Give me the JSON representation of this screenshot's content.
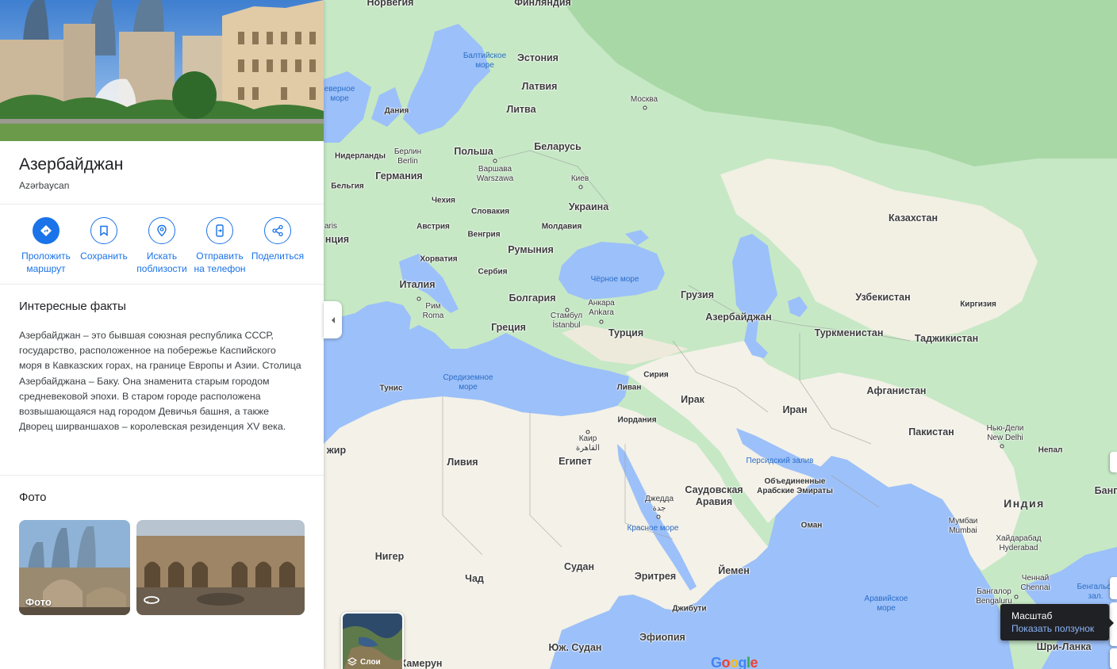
{
  "place": {
    "title": "Азербайджан",
    "subtitle": "Azərbaycan"
  },
  "actions": [
    {
      "label": "Проложить\nмаршрут",
      "icon": "directions-icon"
    },
    {
      "label": "Сохранить",
      "icon": "bookmark-icon"
    },
    {
      "label": "Искать\nпоблизости",
      "icon": "nearby-icon"
    },
    {
      "label": "Отправить\nна телефон",
      "icon": "send-to-phone-icon"
    },
    {
      "label": "Поделиться",
      "icon": "share-icon"
    }
  ],
  "facts": {
    "title": "Интересные факты",
    "text": "Азербайджан – это бывшая союзная республика СССР, государство, расположенное на побережье Каспийского моря в Кавказских горах, на границе Европы и Азии. Столица Азербайджана – Баку. Она знаменита старым городом средневековой эпохи. В старом городе расположена возвышающаяся над городом Девичья башня, а также Дворец ширваншахов – королевская резиденция XV века."
  },
  "photos": {
    "title": "Фото",
    "first_caption": "Фото",
    "second_icon": "360-view-icon"
  },
  "map": {
    "labels": {
      "norway": "Норвегия",
      "finland": "Финляндия",
      "estonia": "Эстония",
      "latvia": "Латвия",
      "lithuania": "Литва",
      "denmark": "Дания",
      "belarus": "Беларусь",
      "poland": "Польша",
      "germany": "Германия",
      "netherlands": "Нидерланды",
      "belgium": "Бельгия",
      "czechia": "Чехия",
      "slovakia": "Словакия",
      "austria": "Австрия",
      "hungary": "Венгрия",
      "moldova": "Молдавия",
      "ukraine": "Украина",
      "romania": "Румыния",
      "croatia": "Хорватия",
      "serbia": "Сербия",
      "italy": "Италия",
      "bulgaria": "Болгария",
      "greece": "Греция",
      "turkey": "Турция",
      "georgia": "Грузия",
      "azerbaijan": "Азербайджан",
      "kazakhstan": "Казахстан",
      "uzbekistan": "Узбекистан",
      "kyrgyzstan": "Киргизия",
      "turkmenistan": "Туркменистан",
      "tajikistan": "Таджикистан",
      "afghanistan": "Афганистан",
      "iran": "Иран",
      "iraq": "Ирак",
      "syria": "Сирия",
      "lebanon": "Ливан",
      "jordan": "Иордания",
      "pakistan": "Пакистан",
      "india": "Индия",
      "nepal": "Непал",
      "tunisia": "Тунис",
      "libya": "Ливия",
      "egypt": "Египет",
      "saudi": "Саудовская\nАравия",
      "uae": "Объединенные\nАрабские Эмираты",
      "oman": "Оман",
      "yemen": "Йемен",
      "sudan": "Судан",
      "eritrea": "Эритрея",
      "djibouti": "Джибути",
      "ethiopia": "Эфиопия",
      "south_sudan": "Юж. Судан",
      "chad": "Чад",
      "niger": "Нигер",
      "algeria_part": "жир",
      "cameroon": "Камерун",
      "france_part": "нция",
      "paris_part": "aris",
      "sri_lanka": "Шри-Ланка",
      "bangladesh_part": "Банг",
      "moscow": "Москва",
      "berlin": "Берлин\nBerlin",
      "warsaw": "Варшава\nWarszawa",
      "kyiv": "Киев",
      "rome": "Рим\nRoma",
      "istanbul": "Стамбул\nİstanbul",
      "ankara": "Анкара\nAnkara",
      "cairo": "Каир\nالقاهرة",
      "jeddah": "Джедда\nجدة",
      "new_delhi": "Нью-Дели\nNew Delhi",
      "mumbai": "Мумбаи\nMumbai",
      "hyderabad": "Хайдарабад\nHyderabad",
      "chennai": "Ченнай\nChennai",
      "bengaluru": "Бангалор\nBengaluru",
      "baltic_sea": "Балтийское\nморе",
      "north_sea": "еверное\nморе",
      "black_sea": "Чёрное море",
      "mediterranean": "Средиземное\nморе",
      "persian_gulf": "Персидский залив",
      "red_sea": "Красное море",
      "arabian_sea": "Аравийское\nморе",
      "bengal_bay": "Бенгальск\nзал."
    },
    "layers_label": "Слои",
    "google": "Google",
    "zoom_tooltip": {
      "title": "Масштаб",
      "link": "Показать ползунок"
    }
  },
  "colors": {
    "accent": "#1a73e8",
    "water": "#aadaff",
    "land_green": "#bfe3c0",
    "desert": "#f5f0e4"
  }
}
